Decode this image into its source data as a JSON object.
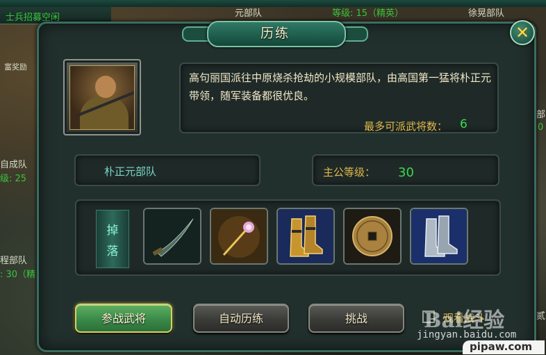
{
  "background": {
    "recruit_status": "士兵招募空闲",
    "troop_top": "元部队",
    "level_tag": "等级: 15（精英）",
    "xuhuang_troop": "徐晃部队",
    "reward_tag": "富奖励",
    "left_troop": "自成队",
    "left_level": "级: 25",
    "cheng_troop": "程部队",
    "cheng_level": ": 30（精",
    "right_fragment_1": "部",
    "right_fragment_2": "0",
    "right_fragment_3": "贰"
  },
  "dialog": {
    "title": "历练",
    "close_icon": "close-x-icon",
    "description": "高句丽国派往中原烧杀抢劫的小规模部队，由高国第一猛将朴正元带领，随军装备都很优良。",
    "max_generals_label": "最多可派武将数：",
    "max_generals_value": "6",
    "troop_name": "朴正元部队",
    "lord_level_label": "主公等级：",
    "lord_level_value": "30",
    "drops_label_1": "掉",
    "drops_label_2": "落",
    "drops": [
      {
        "icon": "curved-sword-icon"
      },
      {
        "icon": "flower-hairpin-icon"
      },
      {
        "icon": "golden-boots-icon"
      },
      {
        "icon": "bronze-coin-icon"
      },
      {
        "icon": "silver-boots-icon"
      }
    ],
    "buttons": {
      "join_generals": "参战武将",
      "auto_train": "自动历练",
      "challenge": "挑战"
    },
    "checkbox_label": "观看战斗"
  },
  "watermarks": {
    "baidu": "Bai经验",
    "url": "jingyan.baidu.com",
    "pipaw": "pipaw.com"
  },
  "colors": {
    "accent_green": "#3bd84b",
    "gold": "#e2b84a",
    "dialog_bg": "#22302d"
  }
}
